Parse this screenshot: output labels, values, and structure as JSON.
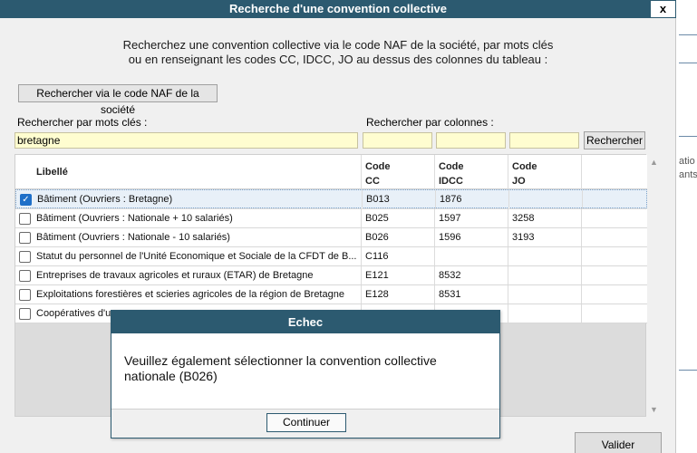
{
  "dialog": {
    "title": "Recherche d'une convention collective",
    "close_label": "x",
    "intro_line1": "Recherchez une convention collective via le code NAF de la société, par mots clés",
    "intro_line2": "ou en renseignant les codes CC, IDCC, JO au dessus des colonnes du tableau :",
    "naf_button_label": "Rechercher via le code NAF de la société",
    "keywords_label": "Rechercher par mots clés :",
    "keywords_value": "bretagne",
    "columns_label": "Rechercher par colonnes :",
    "cc_value": "",
    "idcc_value": "",
    "jo_value": "",
    "search_button_label": "Rechercher",
    "validate_button_label": "Valider"
  },
  "table": {
    "headers": {
      "libelle": "Libellé",
      "cc_line1": "Code",
      "cc_line2": "CC",
      "idcc_line1": "Code",
      "idcc_line2": "IDCC",
      "jo_line1": "Code",
      "jo_line2": "JO"
    },
    "rows": [
      {
        "checked": true,
        "libelle": "Bâtiment (Ouvriers : Bretagne)",
        "cc": "B013",
        "idcc": "1876",
        "jo": ""
      },
      {
        "checked": false,
        "libelle": "Bâtiment (Ouvriers : Nationale + 10 salariés)",
        "cc": "B025",
        "idcc": "1597",
        "jo": "3258"
      },
      {
        "checked": false,
        "libelle": "Bâtiment (Ouvriers : Nationale - 10 salariés)",
        "cc": "B026",
        "idcc": "1596",
        "jo": "3193"
      },
      {
        "checked": false,
        "libelle": "Statut du personnel de l'Unité Economique et Sociale de la CFDT de B...",
        "cc": "C116",
        "idcc": "",
        "jo": ""
      },
      {
        "checked": false,
        "libelle": "Entreprises de travaux agricoles et ruraux (ETAR) de Bretagne",
        "cc": "E121",
        "idcc": "8532",
        "jo": ""
      },
      {
        "checked": false,
        "libelle": "Exploitations forestières et scieries agricoles de la région de Bretagne",
        "cc": "E128",
        "idcc": "8531",
        "jo": ""
      },
      {
        "checked": false,
        "libelle": "Coopératives d'u",
        "cc": "",
        "idcc": "",
        "jo": ""
      }
    ]
  },
  "background_window": {
    "text1": "atio",
    "text2": "ants"
  },
  "modal": {
    "title": "Echec",
    "message_line1": "Veuillez également sélectionner la convention collective",
    "message_line2": "nationale (B026)",
    "continue_label": "Continuer"
  },
  "colors": {
    "titlebar": "#2c5a70",
    "field_bg": "#fffdd0",
    "checkbox_checked": "#1e6fc8"
  },
  "icons": {
    "close": "close-icon",
    "check": "checkmark-icon",
    "scroll_up": "scroll-up-arrow-icon",
    "scroll_down": "scroll-down-arrow-icon"
  }
}
